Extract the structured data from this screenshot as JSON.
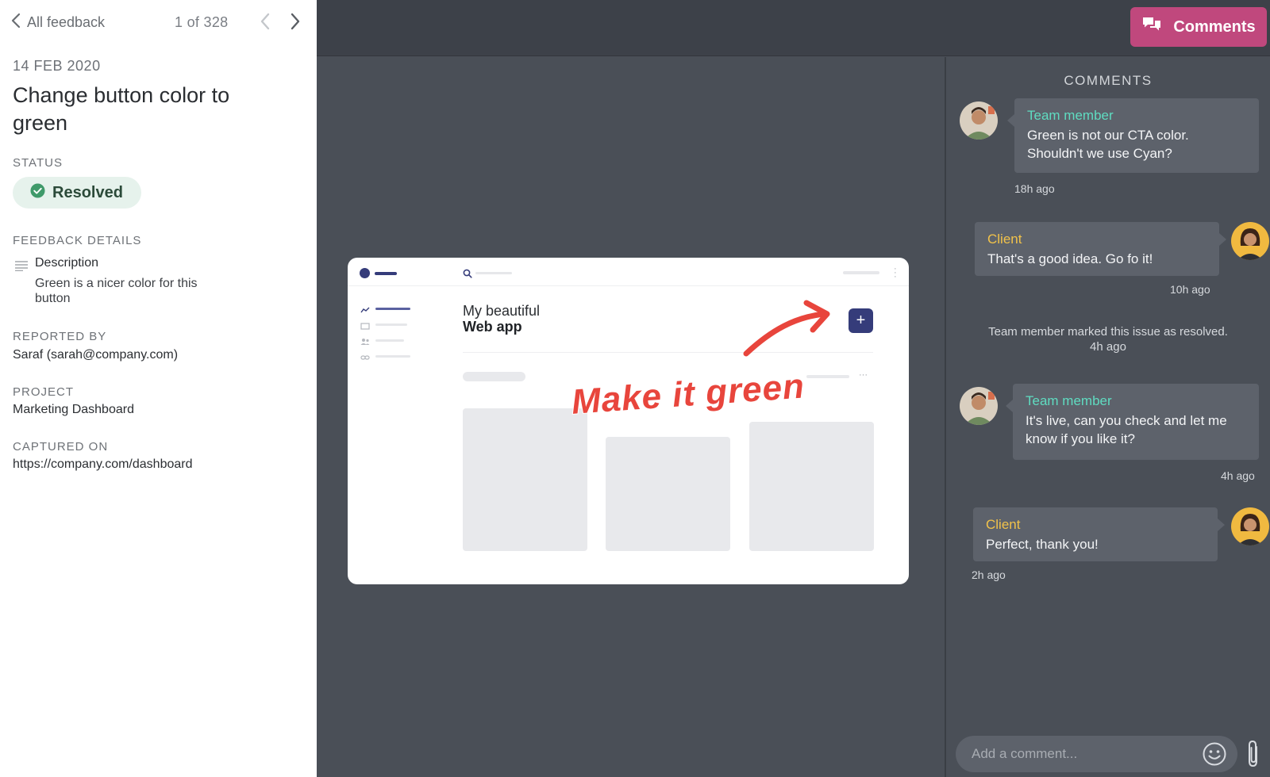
{
  "left": {
    "back_label": "All feedback",
    "counter": "1 of 328",
    "date": "14 FEB 2020",
    "title": "Change button color to green",
    "status_label": "STATUS",
    "status_value": "Resolved",
    "details_label": "FEEDBACK DETAILS",
    "description_heading": "Description",
    "description_text": "Green is a nicer color for this button",
    "reported_label": "REPORTED BY",
    "reported_value": "Saraf (sarah@company.com)",
    "project_label": "PROJECT",
    "project_value": "Marketing Dashboard",
    "captured_label": "CAPTURED ON",
    "captured_value": "https://company.com/dashboard"
  },
  "topbar": {
    "comments_button": "Comments"
  },
  "mockup": {
    "heading_line1": "My beautiful",
    "heading_line2": "Web app",
    "plus_label": "+",
    "annotation": "Make it green"
  },
  "comments": {
    "header": "COMMENTS",
    "items": [
      {
        "author": "Team member",
        "text": "Green is not our CTA color. Shouldn't we use Cyan?",
        "time": "18h ago"
      },
      {
        "author": "Client",
        "text": "That's a good idea. Go fo it!",
        "time": "10h ago"
      },
      {
        "author": "Team member",
        "text": "It's live, can you check and let me know if you like it?",
        "time": "4h ago"
      },
      {
        "author": "Client",
        "text": "Perfect, thank you!",
        "time": "2h ago"
      }
    ],
    "system_message": "Team member marked this issue as resolved.",
    "system_time": "4h ago",
    "input_placeholder": "Add a comment..."
  },
  "colors": {
    "accent_pink": "#c0487d",
    "resolved_bg": "#e6f2ec",
    "resolved_icon": "#3f9a6a",
    "team_name": "#5fdcc1",
    "client_name": "#f1c24a",
    "annotation_red": "#e8453c",
    "mock_primary": "#353c7a"
  },
  "icons": [
    "chevron-left-icon",
    "chevron-right-icon",
    "check-circle-icon",
    "text-lines-icon",
    "chat-icon",
    "search-icon",
    "emoji-icon",
    "paperclip-icon"
  ]
}
